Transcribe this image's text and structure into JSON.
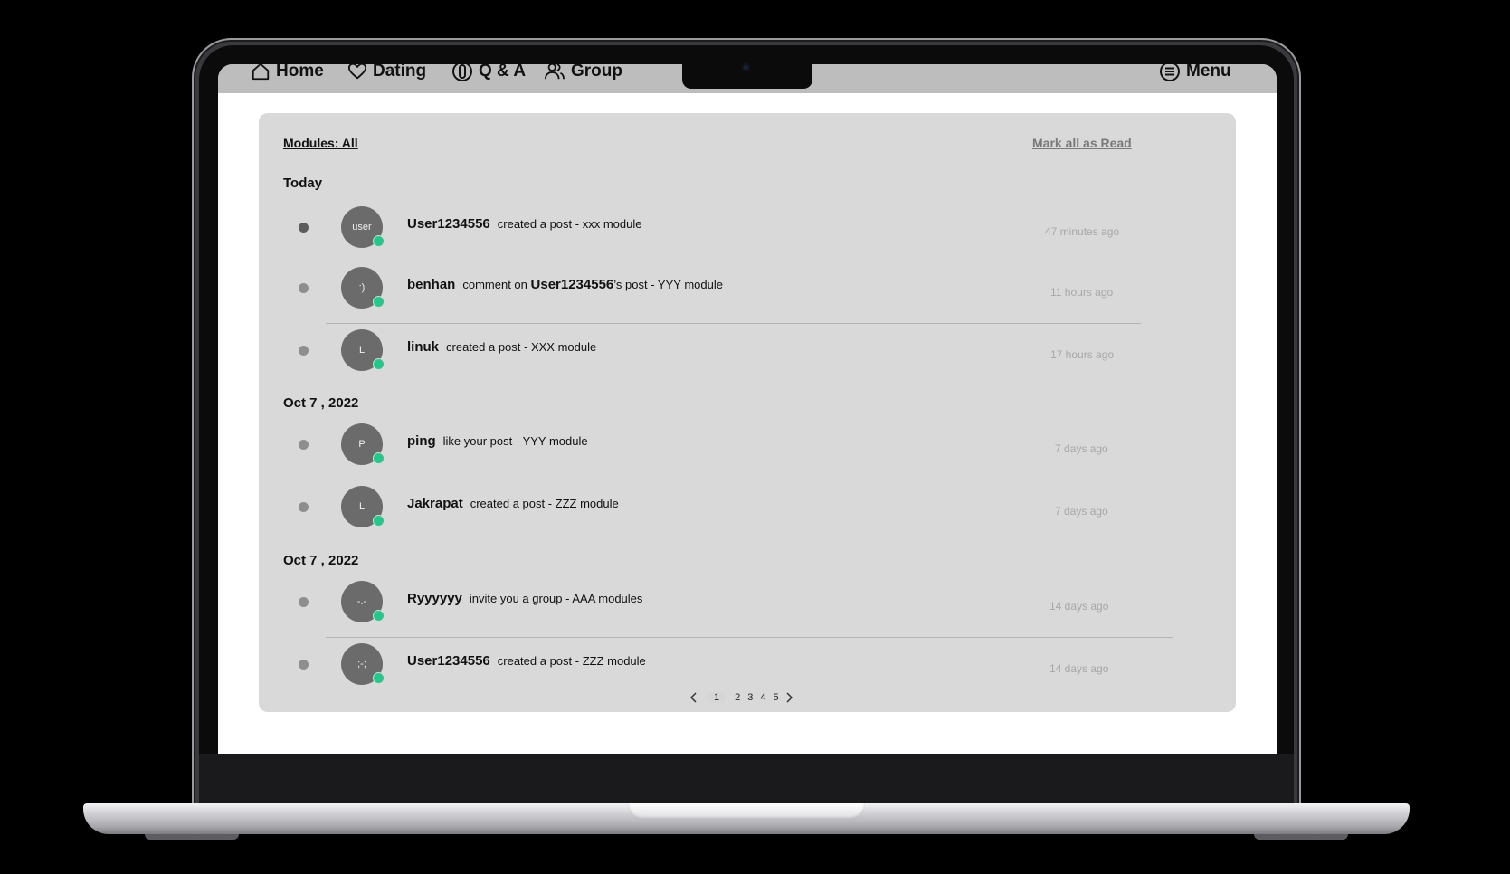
{
  "nav": {
    "home_label": "Home",
    "dating_label": "Dating",
    "qa_label": "Q & A",
    "group_label": "Group",
    "menu_label": "Menu"
  },
  "panel": {
    "filter_label": "Modules: All",
    "mark_all_read_label": "Mark all as Read"
  },
  "sections": [
    {
      "heading": "Today",
      "items": [
        {
          "avatar_text": "user",
          "user": "User1234556",
          "action": "created a post - xxx module",
          "time": "47 minutes ago",
          "unread": true,
          "online": true
        },
        {
          "avatar_text": ":)",
          "user": "benhan",
          "action_prefix": "comment on",
          "target_user": "User1234556",
          "action_suffix": "’s post - YYY module",
          "time": "11 hours ago",
          "unread": false,
          "online": true
        },
        {
          "avatar_text": "L",
          "user": "linuk",
          "action": "created a post - XXX module",
          "time": "17 hours ago",
          "unread": false,
          "online": true
        }
      ]
    },
    {
      "heading": "Oct 7 , 2022",
      "items": [
        {
          "avatar_text": "P",
          "user": "ping",
          "action": "like your post - YYY module",
          "time": "7 days ago",
          "unread": false,
          "online": true
        },
        {
          "avatar_text": "L",
          "user": "Jakrapat",
          "action": "created a post - ZZZ module",
          "time": "7 days ago",
          "unread": false,
          "online": true
        }
      ]
    },
    {
      "heading": "Oct 7 , 2022",
      "items": [
        {
          "avatar_text": "-.-",
          "user": "Ryyyyyy",
          "action": "invite you a group - AAA modules",
          "time": "14 days ago",
          "unread": false,
          "online": true
        },
        {
          "avatar_text": ";-;",
          "user": "User1234556",
          "action": "created a post - ZZZ module",
          "time": "14 days ago",
          "unread": false,
          "online": true
        }
      ]
    }
  ],
  "pagination": {
    "pages": [
      "1",
      "2",
      "3",
      "4",
      "5"
    ],
    "current": "1"
  },
  "colors": {
    "online_status": "#22c98a",
    "panel_bg": "#d9d9d9",
    "nav_bg": "#bdbdbd"
  }
}
